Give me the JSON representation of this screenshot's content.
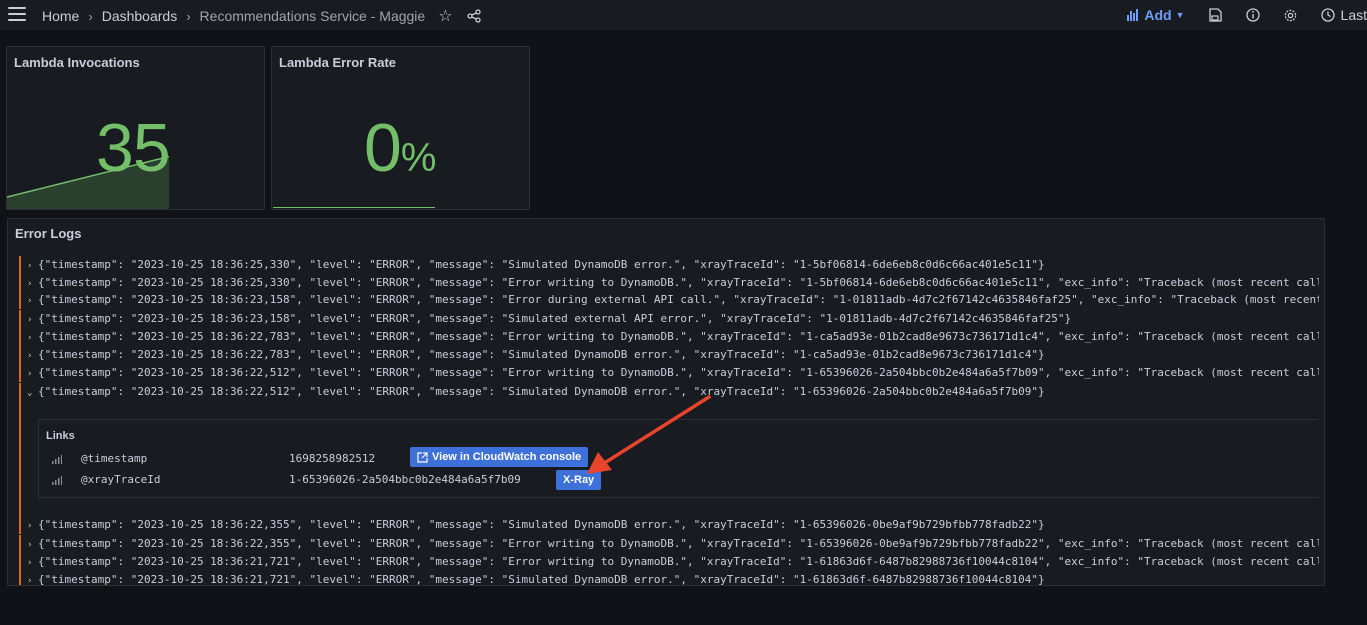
{
  "breadcrumb": {
    "items": [
      "Home",
      "Dashboards",
      "Recommendations Service - Maggie"
    ]
  },
  "toolbar": {
    "add_label": "Add",
    "time_label": "Last",
    "icons": [
      "menu-icon",
      "star-icon",
      "share-icon",
      "save-icon",
      "info-icon",
      "gear-icon",
      "clock-icon"
    ]
  },
  "panels": {
    "invocations": {
      "title": "Lambda Invocations",
      "value": "35",
      "trend_fill": 0.76
    },
    "error_rate": {
      "title": "Lambda Error Rate",
      "value": "0",
      "unit": "%"
    },
    "logs": {
      "title": "Error Logs"
    }
  },
  "log_rows": [
    "{\"timestamp\": \"2023-10-25 18:36:25,330\", \"level\": \"ERROR\", \"message\": \"Simulated DynamoDB error.\", \"xrayTraceId\": \"1-5bf06814-6de6eb8c0d6c66ac401e5c11\"}",
    "{\"timestamp\": \"2023-10-25 18:36:25,330\", \"level\": \"ERROR\", \"message\": \"Error writing to DynamoDB.\", \"xrayTraceId\": \"1-5bf06814-6de6eb8c0d6c66ac401e5c11\", \"exc_info\": \"Traceback (most recent call",
    "{\"timestamp\": \"2023-10-25 18:36:23,158\", \"level\": \"ERROR\", \"message\": \"Error during external API call.\", \"xrayTraceId\": \"1-01811adb-4d7c2f67142c4635846faf25\", \"exc_info\": \"Traceback (most recent",
    "{\"timestamp\": \"2023-10-25 18:36:23,158\", \"level\": \"ERROR\", \"message\": \"Simulated external API error.\", \"xrayTraceId\": \"1-01811adb-4d7c2f67142c4635846faf25\"}",
    "{\"timestamp\": \"2023-10-25 18:36:22,783\", \"level\": \"ERROR\", \"message\": \"Error writing to DynamoDB.\", \"xrayTraceId\": \"1-ca5ad93e-01b2cad8e9673c736171d1c4\", \"exc_info\": \"Traceback (most recent call",
    "{\"timestamp\": \"2023-10-25 18:36:22,783\", \"level\": \"ERROR\", \"message\": \"Simulated DynamoDB error.\", \"xrayTraceId\": \"1-ca5ad93e-01b2cad8e9673c736171d1c4\"}",
    "{\"timestamp\": \"2023-10-25 18:36:22,512\", \"level\": \"ERROR\", \"message\": \"Error writing to DynamoDB.\", \"xrayTraceId\": \"1-65396026-2a504bbc0b2e484a6a5f7b09\", \"exc_info\": \"Traceback (most recent call",
    "{\"timestamp\": \"2023-10-25 18:36:22,512\", \"level\": \"ERROR\", \"message\": \"Simulated DynamoDB error.\", \"xrayTraceId\": \"1-65396026-2a504bbc0b2e484a6a5f7b09\"}",
    "{\"timestamp\": \"2023-10-25 18:36:22,355\", \"level\": \"ERROR\", \"message\": \"Simulated DynamoDB error.\", \"xrayTraceId\": \"1-65396026-0be9af9b729bfbb778fadb22\"}",
    "{\"timestamp\": \"2023-10-25 18:36:22,355\", \"level\": \"ERROR\", \"message\": \"Error writing to DynamoDB.\", \"xrayTraceId\": \"1-65396026-0be9af9b729bfbb778fadb22\", \"exc_info\": \"Traceback (most recent call",
    "{\"timestamp\": \"2023-10-25 18:36:21,721\", \"level\": \"ERROR\", \"message\": \"Error writing to DynamoDB.\", \"xrayTraceId\": \"1-61863d6f-6487b82988736f10044c8104\", \"exc_info\": \"Traceback (most recent call",
    "{\"timestamp\": \"2023-10-25 18:36:21,721\", \"level\": \"ERROR\", \"message\": \"Simulated DynamoDB error.\", \"xrayTraceId\": \"1-61863d6f-6487b82988736f10044c8104\"}"
  ],
  "details": {
    "title": "Links",
    "fields": [
      {
        "name": "@timestamp",
        "value": "1698258982512",
        "link": "View in CloudWatch console"
      },
      {
        "name": "@xrayTraceId",
        "value": "1-65396026-2a504bbc0b2e484a6a5f7b09",
        "link": "X-Ray"
      }
    ]
  },
  "colors": {
    "background": "#111217",
    "panel": "#181b1f",
    "stat_green": "#73bf69",
    "accent_blue": "#6e9fff",
    "link_button": "#3d71d9",
    "log_level_error": "#e0621f",
    "annotation_arrow": "#e8452c"
  }
}
